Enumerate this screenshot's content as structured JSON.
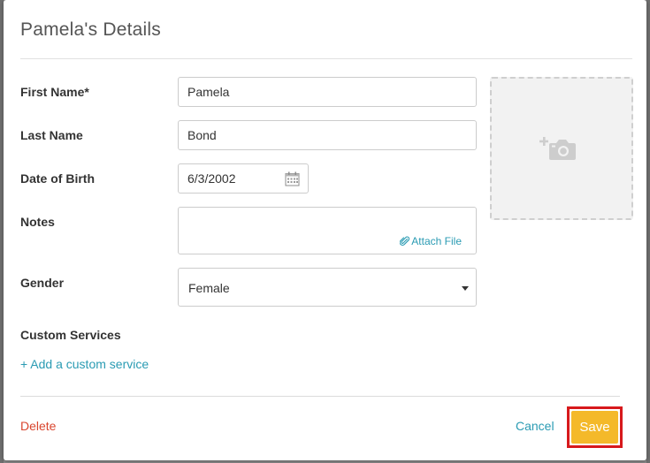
{
  "dialog": {
    "title": "Pamela's Details"
  },
  "fields": {
    "first_name": {
      "label": "First Name*",
      "value": "Pamela"
    },
    "last_name": {
      "label": "Last Name",
      "value": "Bond"
    },
    "date_of_birth": {
      "label": "Date of Birth",
      "value": "6/3/2002"
    },
    "notes": {
      "label": "Notes",
      "value": "",
      "attach_label": "Attach File"
    },
    "gender": {
      "label": "Gender",
      "selected": "Female"
    }
  },
  "custom_services": {
    "label": "Custom Services",
    "add_link": "+ Add a custom service"
  },
  "photo": {
    "icon": "add-photo-icon"
  },
  "footer": {
    "delete_label": "Delete",
    "cancel_label": "Cancel",
    "save_label": "Save"
  },
  "colors": {
    "link": "#2a9bb3",
    "danger": "#d9452e",
    "save": "#f4b92a",
    "highlight": "#d7191c"
  }
}
